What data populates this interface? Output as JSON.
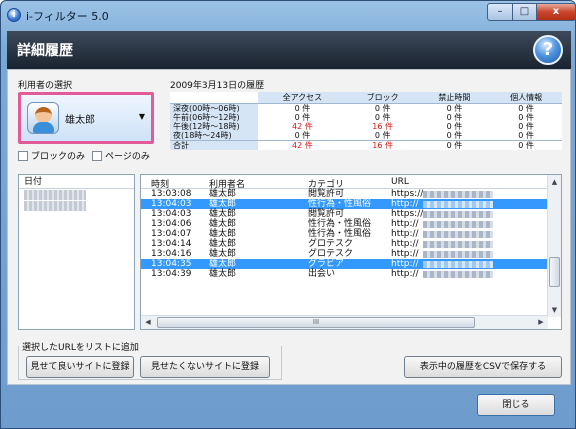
{
  "window": {
    "title": "i-フィルター 5.0",
    "controls": {
      "minimize": "–",
      "maximize": "□",
      "close": "x"
    }
  },
  "header": {
    "title": "詳細履歴",
    "help": "?"
  },
  "user_select": {
    "label": "利用者の選択",
    "value": "雄太郎",
    "chevron": "▼"
  },
  "checkboxes": {
    "block_only": "ブロックのみ",
    "page_only": "ページのみ"
  },
  "summary": {
    "title": "2009年3月13日の履歴",
    "columns": [
      "全アクセス",
      "ブロック",
      "禁止時間",
      "個人情報"
    ],
    "rows": [
      {
        "label": "深夜(00時～06時)",
        "values": [
          "0 件",
          "0 件",
          "0 件",
          "0 件"
        ]
      },
      {
        "label": "午前(06時～12時)",
        "values": [
          "0 件",
          "0 件",
          "0 件",
          "0 件"
        ]
      },
      {
        "label": "午後(12時～18時)",
        "values": [
          "42 件",
          "16 件",
          "0 件",
          "0 件"
        ]
      },
      {
        "label": "夜(18時～24時)",
        "values": [
          "0 件",
          "0 件",
          "0 件",
          "0 件"
        ]
      },
      {
        "label": "合計",
        "values": [
          "42 件",
          "16 件",
          "0 件",
          "0 件"
        ]
      }
    ],
    "highlight_color": "#d61818"
  },
  "date_list": {
    "header": "日付",
    "items_count_visible": 2
  },
  "log": {
    "columns": {
      "time": "時刻",
      "user": "利用者名",
      "category": "カテゴリ",
      "url": "URL"
    },
    "rows": [
      {
        "time": "13:03:08",
        "user": "雄太郎",
        "category": "閲覧許可",
        "url": "https://",
        "selected": false
      },
      {
        "time": "13:04:03",
        "user": "雄太郎",
        "category": "性行為・性風俗",
        "url": "http://",
        "selected": true
      },
      {
        "time": "13:04:03",
        "user": "雄太郎",
        "category": "閲覧許可",
        "url": "https://",
        "selected": false
      },
      {
        "time": "13:04:06",
        "user": "雄太郎",
        "category": "性行為・性風俗",
        "url": "http://",
        "selected": false
      },
      {
        "time": "13:04:07",
        "user": "雄太郎",
        "category": "性行為・性風俗",
        "url": "http://",
        "selected": false
      },
      {
        "time": "13:04:14",
        "user": "雄太郎",
        "category": "グロテスク",
        "url": "http://",
        "selected": false
      },
      {
        "time": "13:04:16",
        "user": "雄太郎",
        "category": "グロテスク",
        "url": "http://",
        "selected": false
      },
      {
        "time": "13:04:35",
        "user": "雄太郎",
        "category": "グラビア",
        "url": "http://",
        "selected": true
      },
      {
        "time": "13:04:39",
        "user": "雄太郎",
        "category": "出会い",
        "url": "http://",
        "selected": false
      }
    ],
    "selection_color": "#3399ff"
  },
  "actions": {
    "group_label": "選択したURLをリストに追加",
    "allow": "見せて良いサイトに登録",
    "deny": "見せたくないサイトに登録",
    "export_csv": "表示中の履歴をCSVで保存する"
  },
  "footer": {
    "close": "閉じる"
  }
}
